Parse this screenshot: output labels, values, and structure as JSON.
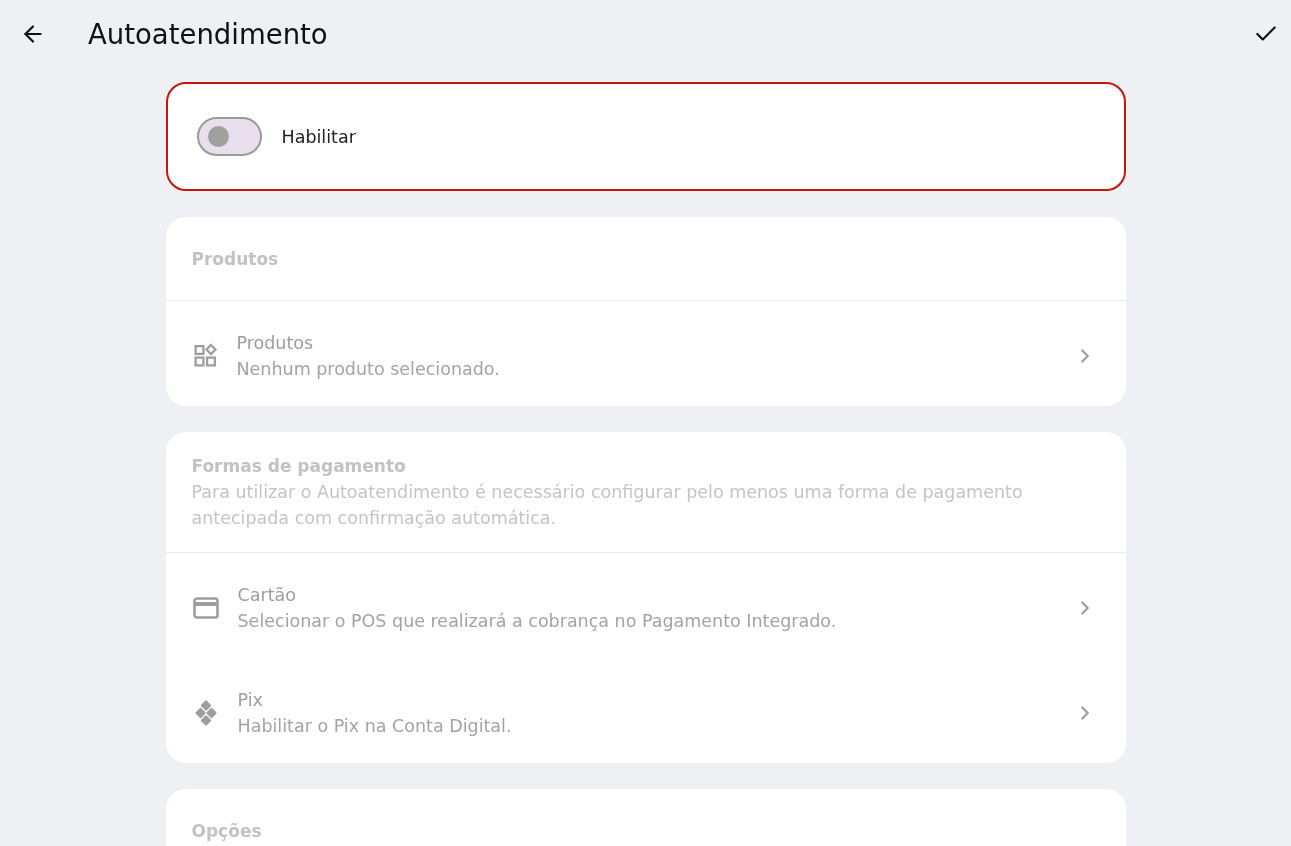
{
  "header": {
    "title": "Autoatendimento"
  },
  "toggle_card": {
    "label": "Habilitar",
    "on": false,
    "highlighted": true
  },
  "sections": [
    {
      "title": "Produtos",
      "disabled": true,
      "rows": [
        {
          "title": "Produtos",
          "subtitle": "Nenhum produto selecionado."
        }
      ]
    },
    {
      "title": "Formas de pagamento",
      "description": "Para utilizar o Autoatendimento é necessário configurar pelo menos uma forma de pagamento antecipada com confirmação automática.",
      "disabled": true,
      "rows": [
        {
          "title": "Cartão",
          "subtitle": "Selecionar o POS que realizará a cobrança no Pagamento Integrado."
        },
        {
          "title": "Pix",
          "subtitle": "Habilitar o Pix na Conta Digital."
        }
      ]
    },
    {
      "title": "Opções",
      "disabled": true
    }
  ]
}
